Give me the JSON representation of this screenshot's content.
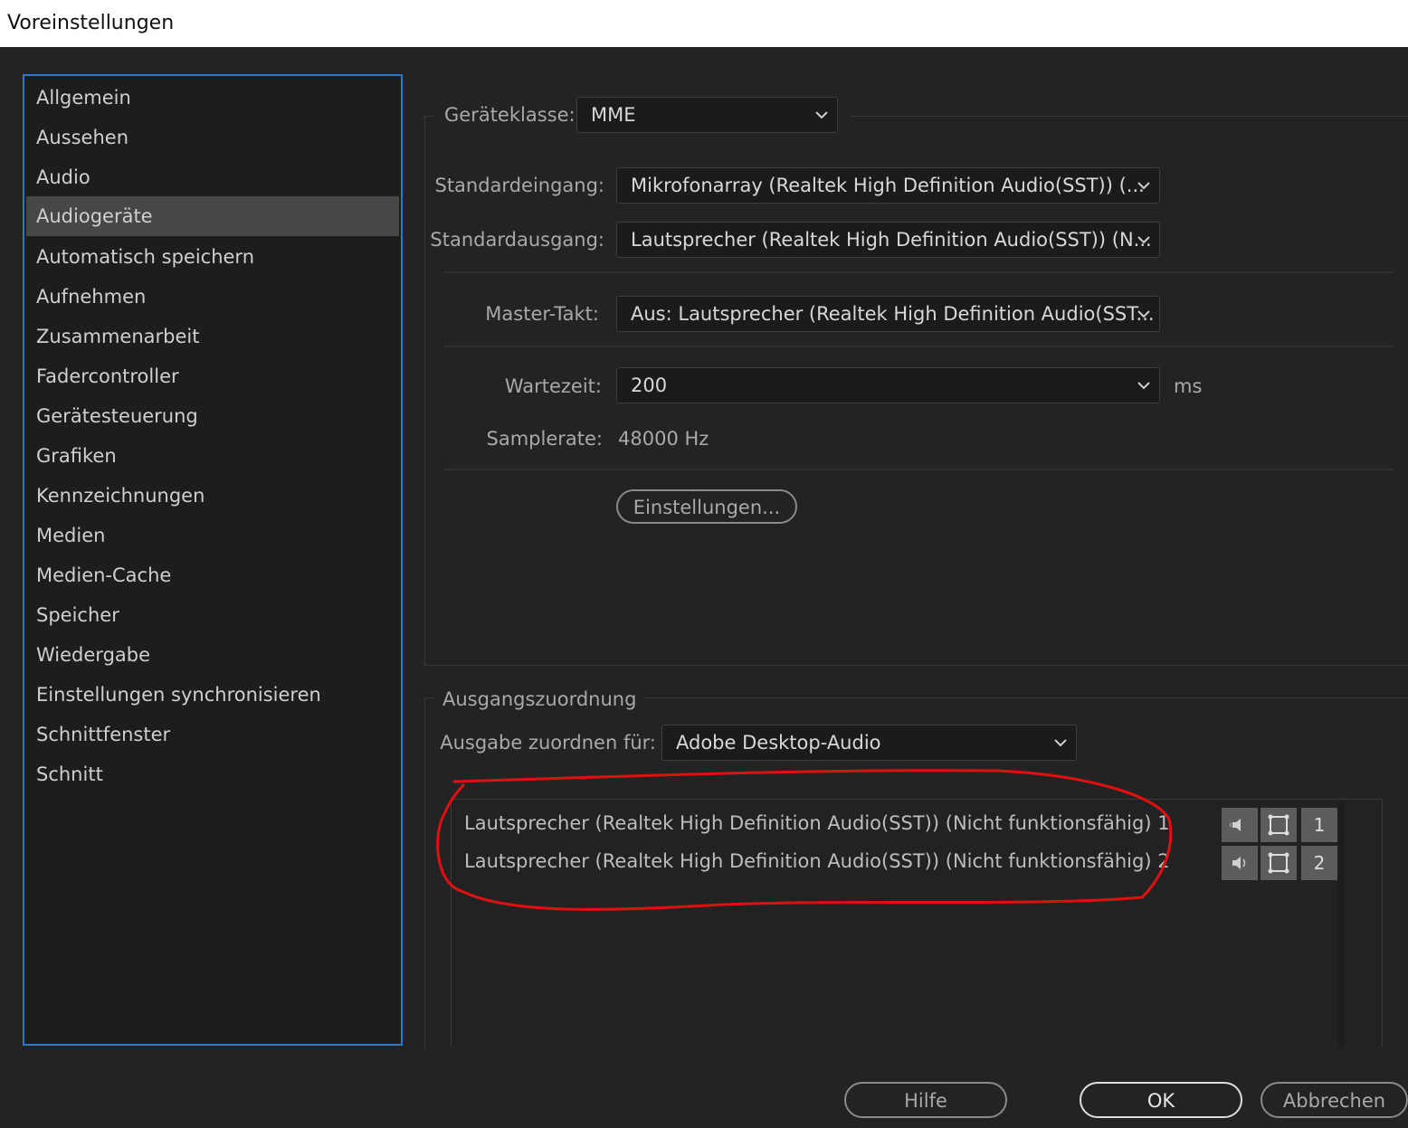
{
  "window": {
    "title": "Voreinstellungen"
  },
  "sidebar": {
    "items": [
      {
        "label": "Allgemein"
      },
      {
        "label": "Aussehen"
      },
      {
        "label": "Audio"
      },
      {
        "label": "Audiogeräte",
        "selected": true
      },
      {
        "label": "Automatisch speichern"
      },
      {
        "label": "Aufnehmen"
      },
      {
        "label": "Zusammenarbeit"
      },
      {
        "label": "Fadercontroller"
      },
      {
        "label": "Gerätesteuerung"
      },
      {
        "label": "Grafiken"
      },
      {
        "label": "Kennzeichnungen"
      },
      {
        "label": "Medien"
      },
      {
        "label": "Medien-Cache"
      },
      {
        "label": "Speicher"
      },
      {
        "label": "Wiedergabe"
      },
      {
        "label": "Einstellungen synchronisieren"
      },
      {
        "label": "Schnittfenster"
      },
      {
        "label": "Schnitt"
      }
    ]
  },
  "device": {
    "class_label": "Geräteklasse:",
    "class_value": "MME",
    "input_label": "Standardeingang:",
    "input_value": "Mikrofonarray (Realtek High Definition Audio(SST)) (...",
    "output_label": "Standardausgang:",
    "output_value": "Lautsprecher (Realtek High Definition Audio(SST)) (N...",
    "master_label": "Master-Takt:",
    "master_value": "Aus: Lautsprecher (Realtek High Definition Audio(SST...",
    "latency_label": "Wartezeit:",
    "latency_value": "200",
    "latency_unit": "ms",
    "samplerate_label": "Samplerate:",
    "samplerate_value": "48000 Hz",
    "settings_button": "Einstellungen..."
  },
  "output_mapping": {
    "section_title": "Ausgangszuordnung",
    "map_label": "Ausgabe zuordnen für:",
    "map_value": "Adobe Desktop-Audio",
    "rows": [
      {
        "name": "Lautsprecher (Realtek High Definition Audio(SST)) (Nicht funktionsfähig) 1",
        "channel": "1"
      },
      {
        "name": "Lautsprecher (Realtek High Definition Audio(SST)) (Nicht funktionsfähig) 2",
        "channel": "2"
      }
    ]
  },
  "footer": {
    "help": "Hilfe",
    "ok": "OK",
    "cancel": "Abbrechen"
  },
  "colors": {
    "background": "#232323",
    "selection": "#474747",
    "sidebar_border": "#2d78c8",
    "annotation": "#e01010"
  }
}
